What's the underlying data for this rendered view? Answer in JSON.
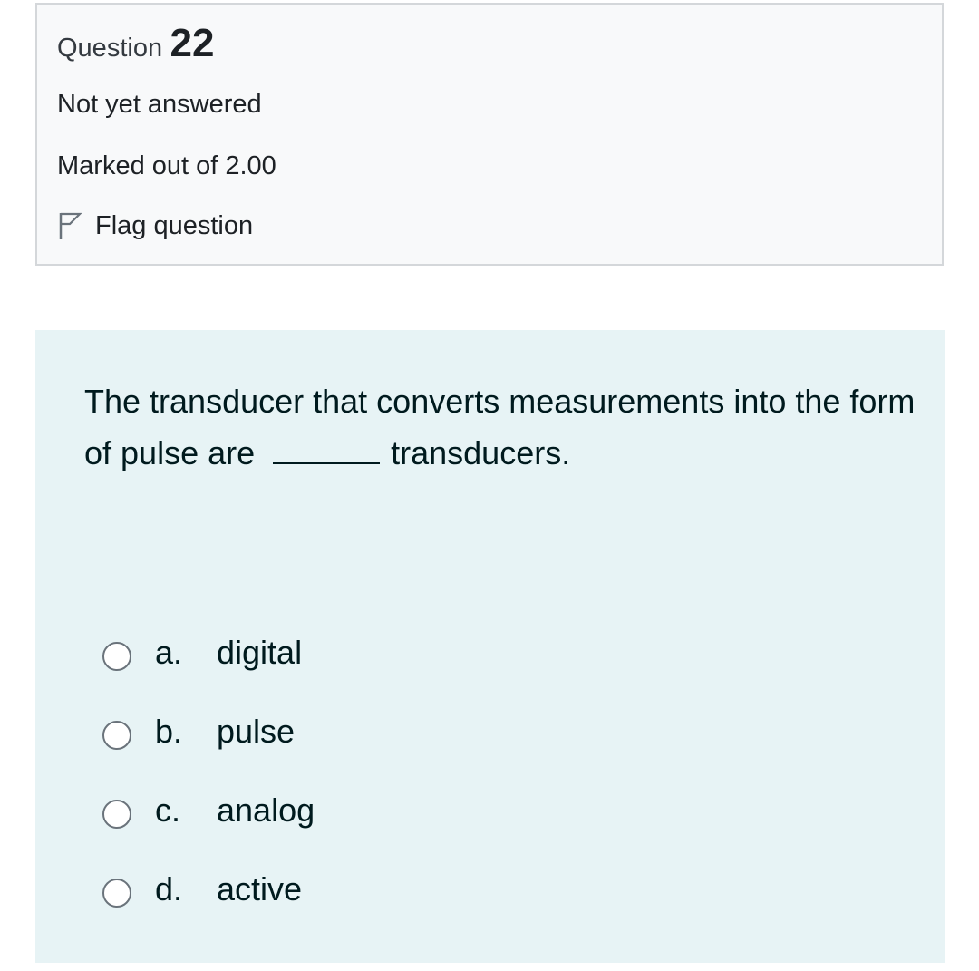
{
  "question_info": {
    "label": "Question",
    "number": "22",
    "state": "Not yet answered",
    "grade": "Marked out of 2.00",
    "flag_label": "Flag question",
    "flag_icon": "flag-outline-icon"
  },
  "question": {
    "text_before": "The transducer that converts measurements into the form of pulse are",
    "text_after": "transducers."
  },
  "options": [
    {
      "letter": "a.",
      "text": "digital"
    },
    {
      "letter": "b.",
      "text": "pulse"
    },
    {
      "letter": "c.",
      "text": "analog"
    },
    {
      "letter": "d.",
      "text": "active"
    }
  ],
  "colors": {
    "info_background": "#f8f9fa",
    "info_border": "#d4d7da",
    "content_background": "#e7f3f5",
    "text": "#001a1e",
    "radio_border": "#6a737b"
  }
}
